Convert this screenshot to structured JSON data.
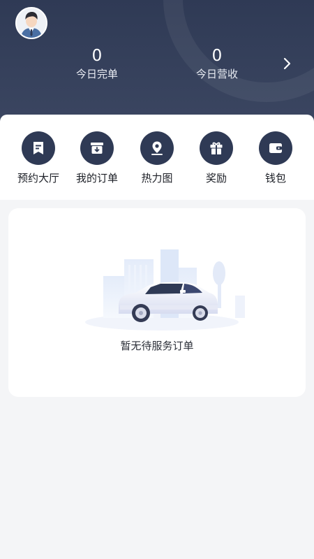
{
  "header": {
    "stats": [
      {
        "value": "0",
        "label": "今日完单"
      },
      {
        "value": "0",
        "label": "今日营收"
      }
    ]
  },
  "menu": {
    "items": [
      {
        "label": "预约大厅",
        "icon": "bookmark-document-icon"
      },
      {
        "label": "我的订单",
        "icon": "order-box-icon"
      },
      {
        "label": "热力图",
        "icon": "location-pin-icon"
      },
      {
        "label": "奖励",
        "icon": "gift-icon"
      },
      {
        "label": "钱包",
        "icon": "wallet-icon"
      }
    ]
  },
  "empty_state": {
    "message": "暂无待服务订单"
  },
  "colors": {
    "header_bg": "#2f3a55",
    "icon_bg": "#2f3a55",
    "page_bg": "#f4f5f7"
  }
}
